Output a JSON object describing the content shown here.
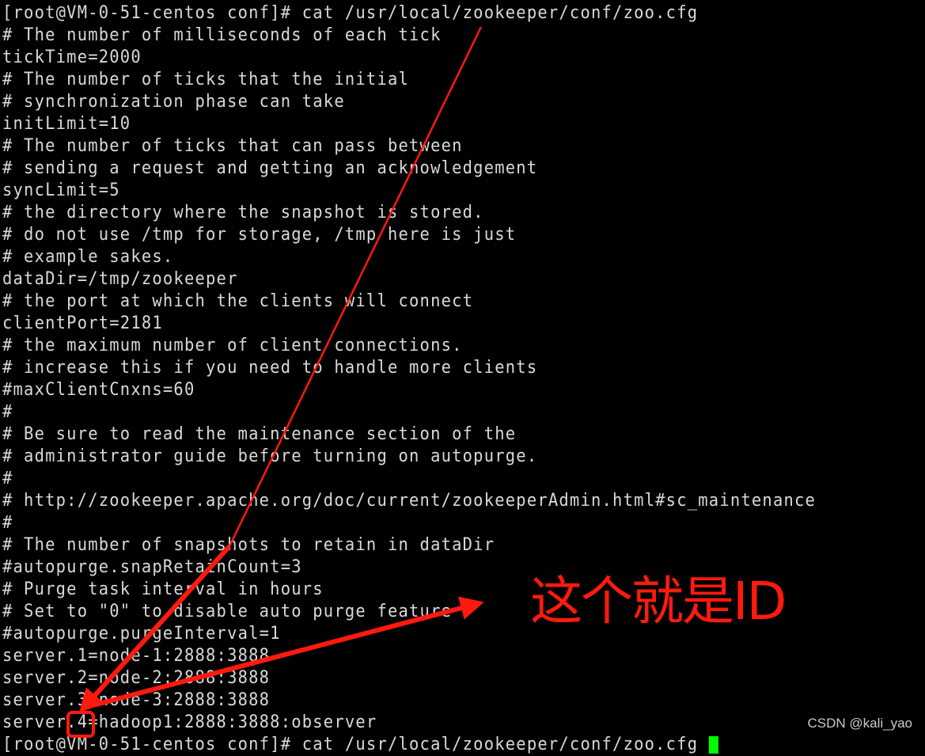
{
  "terminal": {
    "lines": [
      "[root@VM-0-51-centos conf]# cat /usr/local/zookeeper/conf/zoo.cfg",
      "# The number of milliseconds of each tick",
      "tickTime=2000",
      "# The number of ticks that the initial",
      "# synchronization phase can take",
      "initLimit=10",
      "# The number of ticks that can pass between",
      "# sending a request and getting an acknowledgement",
      "syncLimit=5",
      "# the directory where the snapshot is stored.",
      "# do not use /tmp for storage, /tmp here is just",
      "# example sakes.",
      "dataDir=/tmp/zookeeper",
      "# the port at which the clients will connect",
      "clientPort=2181",
      "# the maximum number of client connections.",
      "# increase this if you need to handle more clients",
      "#maxClientCnxns=60",
      "#",
      "# Be sure to read the maintenance section of the",
      "# administrator guide before turning on autopurge.",
      "#",
      "# http://zookeeper.apache.org/doc/current/zookeeperAdmin.html#sc_maintenance",
      "#",
      "# The number of snapshots to retain in dataDir",
      "#autopurge.snapRetainCount=3",
      "# Purge task interval in hours",
      "# Set to \"0\" to disable auto purge feature",
      "#autopurge.purgeInterval=1",
      "server.1=node-1:2888:3888",
      "server.2=node-2:2888:3888",
      "server.3=node-3:2888:3888",
      "server.4=hadoop1:2888:3888:observer",
      "[root@VM-0-51-centos conf]# cat /usr/local/zookeeper/conf/zoo.cfg"
    ],
    "cursor_color": "#00ff00"
  },
  "annotation": {
    "label": "这个就是ID",
    "highlighted_value": "4",
    "color": "#ff1a0e"
  },
  "watermark": "CSDN @kali_yao"
}
